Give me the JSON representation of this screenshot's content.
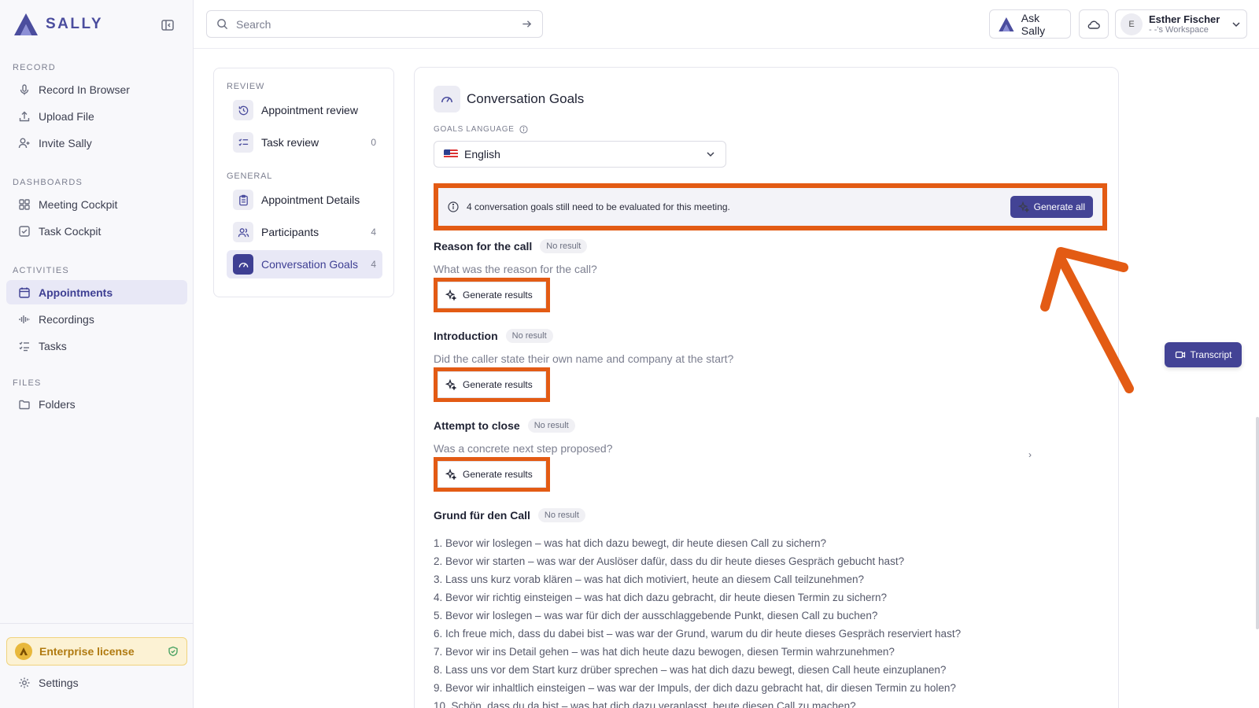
{
  "brand": {
    "name": "SALLY",
    "accent": "#434395",
    "annotation_color": "#e35b14"
  },
  "sidebar": {
    "sections": [
      {
        "title": "RECORD",
        "items": [
          {
            "label": "Record In Browser",
            "icon": "mic-icon"
          },
          {
            "label": "Upload File",
            "icon": "upload-icon"
          },
          {
            "label": "Invite Sally",
            "icon": "user-plus-icon"
          }
        ]
      },
      {
        "title": "DASHBOARDS",
        "items": [
          {
            "label": "Meeting Cockpit",
            "icon": "grid-icon"
          },
          {
            "label": "Task Cockpit",
            "icon": "check-square-icon"
          }
        ]
      },
      {
        "title": "ACTIVITIES",
        "items": [
          {
            "label": "Appointments",
            "icon": "calendar-icon",
            "active": true
          },
          {
            "label": "Recordings",
            "icon": "waveform-icon"
          },
          {
            "label": "Tasks",
            "icon": "list-check-icon"
          }
        ]
      },
      {
        "title": "FILES",
        "items": [
          {
            "label": "Folders",
            "icon": "folder-icon"
          }
        ]
      }
    ],
    "license_label": "Enterprise license",
    "settings_label": "Settings"
  },
  "header": {
    "search_placeholder": "Search",
    "ask_label": "Ask Sally",
    "user_name": "Esther Fischer",
    "user_initial": "E",
    "workspace": "- -'s Workspace"
  },
  "subnav": {
    "review_title": "REVIEW",
    "general_title": "GENERAL",
    "items": [
      {
        "label": "Appointment review",
        "count": ""
      },
      {
        "label": "Task review",
        "count": "0"
      },
      {
        "label": "Appointment Details",
        "count": ""
      },
      {
        "label": "Participants",
        "count": "4"
      },
      {
        "label": "Conversation Goals",
        "count": "4"
      }
    ]
  },
  "main": {
    "title": "Conversation Goals",
    "lang_label": "GOALS LANGUAGE",
    "lang_value": "English",
    "info_text": "4 conversation goals still need to be evaluated for this meeting.",
    "generate_all": "Generate all",
    "generate_results": "Generate results",
    "no_result": "No result",
    "goals": [
      {
        "title": "Reason for the call",
        "question": "What was the reason for the call?"
      },
      {
        "title": "Introduction",
        "question": "Did the caller state their own name and company at the start?"
      },
      {
        "title": "Attempt to close",
        "question": "Was a concrete next step proposed?"
      },
      {
        "title": "Grund für den Call"
      }
    ],
    "chevron": "›",
    "list": [
      "1. Bevor wir loslegen – was hat dich dazu bewegt, dir heute diesen Call zu sichern?",
      "2. Bevor wir starten – was war der Auslöser dafür, dass du dir heute dieses Gespräch gebucht hast?",
      "3. Lass uns kurz vorab klären – was hat dich motiviert, heute an diesem Call teilzunehmen?",
      "4. Bevor wir richtig einsteigen – was hat dich dazu gebracht, dir heute diesen Termin zu sichern?",
      "5. Bevor wir loslegen – was war für dich der ausschlaggebende Punkt, diesen Call zu buchen?",
      "6. Ich freue mich, dass du dabei bist – was war der Grund, warum du dir heute dieses Gespräch reserviert hast?",
      "7. Bevor wir ins Detail gehen – was hat dich heute dazu bewogen, diesen Termin wahrzunehmen?",
      "8. Lass uns vor dem Start kurz drüber sprechen – was hat dich dazu bewegt, diesen Call heute einzuplanen?",
      "9. Bevor wir inhaltlich einsteigen – was war der Impuls, der dich dazu gebracht hat, dir diesen Termin zu holen?",
      "10. Schön, dass du da bist – was hat dich dazu veranlasst, heute diesen Call zu machen?"
    ]
  },
  "transcript_label": "Transcript"
}
